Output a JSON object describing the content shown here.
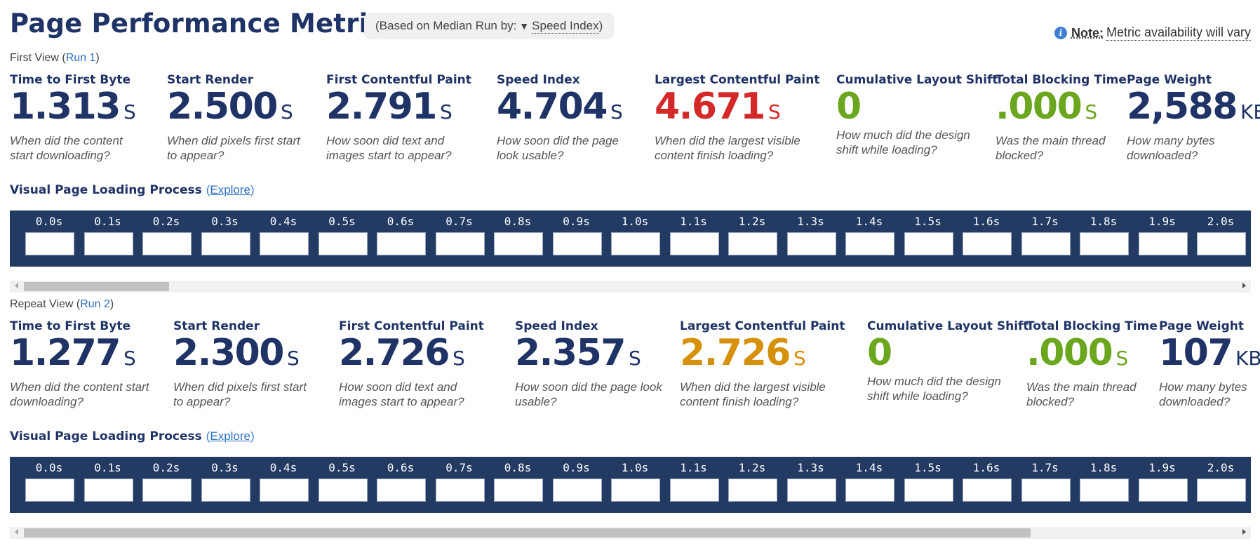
{
  "header": {
    "title": "Page Performance Metrics",
    "median_prefix": "(Based on Median Run by:",
    "median_triangle": "▼",
    "median_metric": "Speed Index",
    "median_suffix": ")",
    "note_label": "Note:",
    "note_text": "Metric availability will vary",
    "info_icon": "info-icon"
  },
  "views": [
    {
      "label": "First View",
      "run_link": "Run 1",
      "metrics": [
        {
          "label": "Time to First Byte",
          "value": "1.313",
          "unit": "S",
          "desc1": "When did the content",
          "desc2": "start downloading?",
          "color": "#1f3366"
        },
        {
          "label": "Start Render",
          "value": "2.500",
          "unit": "S",
          "desc1": "When did pixels first start",
          "desc2": "to appear?",
          "color": "#1f3366"
        },
        {
          "label": "First Contentful Paint",
          "value": "2.791",
          "unit": "S",
          "desc1": "How soon did text and",
          "desc2": "images start to appear?",
          "color": "#1f3366"
        },
        {
          "label": "Speed Index",
          "value": "4.704",
          "unit": "S",
          "desc1": "How soon did the page",
          "desc2": "look usable?",
          "color": "#1f3366"
        },
        {
          "label": "Largest Contentful Paint",
          "value": "4.671",
          "unit": "S",
          "desc1": "When did the largest visible",
          "desc2": "content finish loading?",
          "color": "#d42929"
        },
        {
          "label": "Cumulative Layout Shift",
          "value": "0",
          "unit": "",
          "desc1": "How much did the design",
          "desc2": "shift while loading?",
          "color": "#6aa61e"
        },
        {
          "label": "Total Blocking Time",
          "value": ".000",
          "unit": "S",
          "desc1": "Was the main thread",
          "desc2": "blocked?",
          "color": "#6aa61e"
        },
        {
          "label": "Page Weight",
          "value": "2,588",
          "unit": "KB",
          "desc1": "How many bytes",
          "desc2": "downloaded?",
          "color": "#1f3366"
        }
      ],
      "visual_title": "Visual Page Loading Process",
      "explore_open": "(",
      "explore_link": "Explore",
      "explore_close": ")",
      "frames": [
        "0.0s",
        "0.1s",
        "0.2s",
        "0.3s",
        "0.4s",
        "0.5s",
        "0.6s",
        "0.7s",
        "0.8s",
        "0.9s",
        "1.0s",
        "1.1s",
        "1.2s",
        "1.3s",
        "1.4s",
        "1.5s",
        "1.6s",
        "1.7s",
        "1.8s",
        "1.9s",
        "2.0s"
      ],
      "scroll_fraction": 0.12
    },
    {
      "label": "Repeat View",
      "run_link": "Run 2",
      "metrics": [
        {
          "label": "Time to First Byte",
          "value": "1.277",
          "unit": "S",
          "desc1": "When did the content start",
          "desc2": "downloading?",
          "color": "#1f3366"
        },
        {
          "label": "Start Render",
          "value": "2.300",
          "unit": "S",
          "desc1": "When did pixels first start",
          "desc2": "to appear?",
          "color": "#1f3366"
        },
        {
          "label": "First Contentful Paint",
          "value": "2.726",
          "unit": "S",
          "desc1": "How soon did text and",
          "desc2": "images start to appear?",
          "color": "#1f3366"
        },
        {
          "label": "Speed Index",
          "value": "2.357",
          "unit": "S",
          "desc1": "How soon did the page look",
          "desc2": "usable?",
          "color": "#1f3366"
        },
        {
          "label": "Largest Contentful Paint",
          "value": "2.726",
          "unit": "S",
          "desc1": "When did the largest visible",
          "desc2": "content finish loading?",
          "color": "#d6900a"
        },
        {
          "label": "Cumulative Layout Shift",
          "value": "0",
          "unit": "",
          "desc1": "How much did the design",
          "desc2": "shift while loading?",
          "color": "#6aa61e"
        },
        {
          "label": "Total Blocking Time",
          "value": ".000",
          "unit": "S",
          "desc1": "Was the main thread",
          "desc2": "blocked?",
          "color": "#6aa61e"
        },
        {
          "label": "Page Weight",
          "value": "107",
          "unit": "KB",
          "desc1": "How many bytes",
          "desc2": "downloaded?",
          "color": "#1f3366"
        }
      ],
      "visual_title": "Visual Page Loading Process",
      "explore_open": "(",
      "explore_link": "Explore",
      "explore_close": ")",
      "frames": [
        "0.0s",
        "0.1s",
        "0.2s",
        "0.3s",
        "0.4s",
        "0.5s",
        "0.6s",
        "0.7s",
        "0.8s",
        "0.9s",
        "1.0s",
        "1.1s",
        "1.2s",
        "1.3s",
        "1.4s",
        "1.5s",
        "1.6s",
        "1.7s",
        "1.8s",
        "1.9s",
        "2.0s"
      ],
      "scroll_fraction": 0.83
    }
  ]
}
